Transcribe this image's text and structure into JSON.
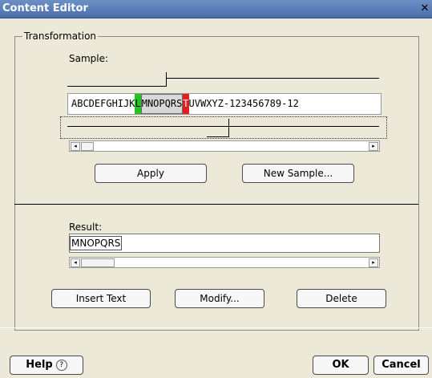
{
  "window": {
    "title": "Content Editor",
    "close_glyph": "✕"
  },
  "transformation": {
    "legend": "Transformation",
    "sample_label": "Sample:",
    "sample_text": {
      "before": "ABCDEFGHIJK",
      "start_marker": "L",
      "selected": "MNOPQRS",
      "end_marker": "T",
      "after": "UVWXYZ-123456789-12"
    },
    "apply_label": "Apply",
    "new_sample_label": "New Sample..."
  },
  "result": {
    "label": "Result:",
    "value": "MNOPQRS",
    "insert_text_label": "Insert Text",
    "modify_label": "Modify...",
    "delete_label": "Delete"
  },
  "footer": {
    "help_label": "Help",
    "help_icon": "?",
    "ok_label": "OK",
    "cancel_label": "Cancel"
  },
  "icons": {
    "scroll_left": "◂",
    "scroll_right": "▸"
  }
}
